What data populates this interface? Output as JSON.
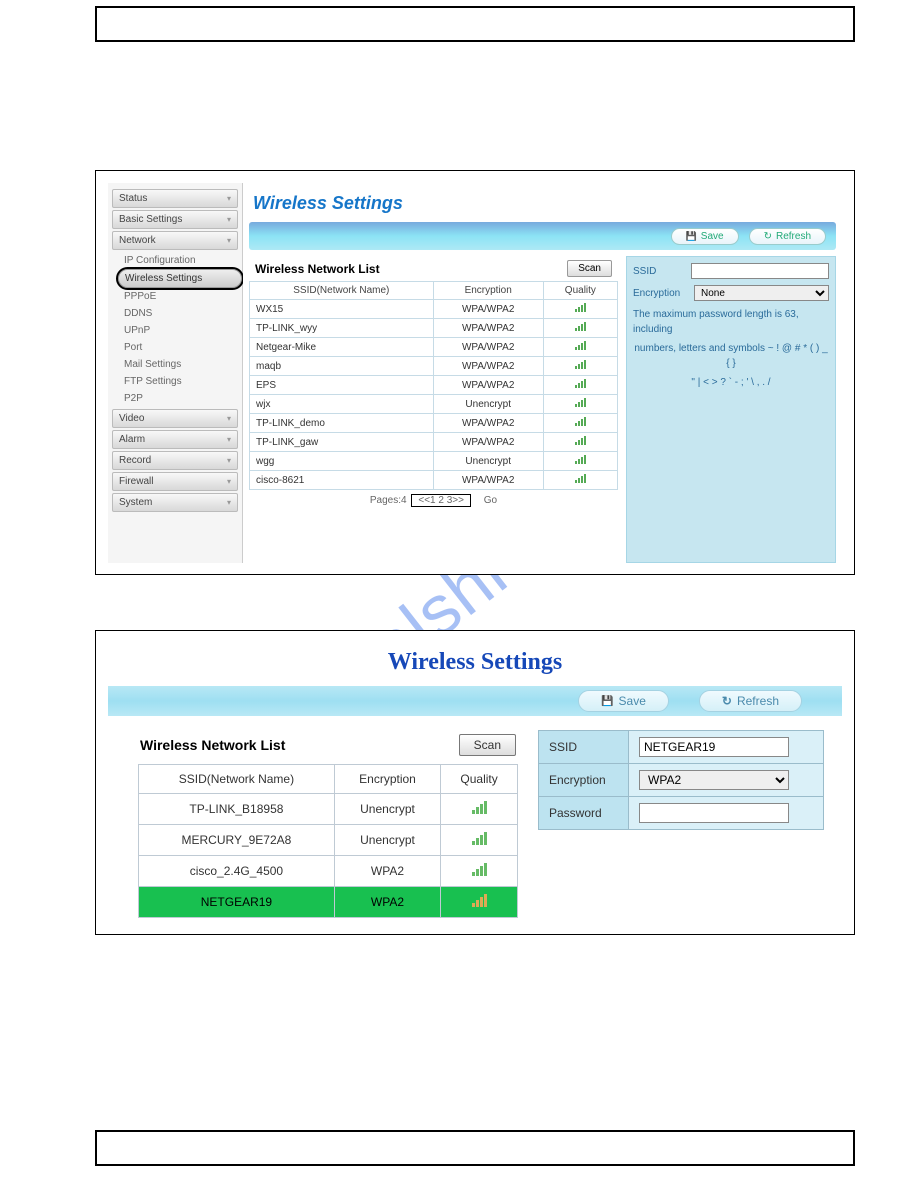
{
  "watermark": "manualshive.com",
  "panel1": {
    "title": "Wireless Settings",
    "toolbar": {
      "save": "Save",
      "refresh": "Refresh"
    },
    "sidebar": {
      "cats": [
        {
          "label": "Status",
          "type": "cat"
        },
        {
          "label": "Basic Settings",
          "type": "cat"
        },
        {
          "label": "Network",
          "type": "cat",
          "expanded": true
        },
        {
          "label": "IP Configuration",
          "type": "sub"
        },
        {
          "label": "Wireless Settings",
          "type": "sub",
          "active": true
        },
        {
          "label": "PPPoE",
          "type": "sub"
        },
        {
          "label": "DDNS",
          "type": "sub"
        },
        {
          "label": "UPnP",
          "type": "sub"
        },
        {
          "label": "Port",
          "type": "sub"
        },
        {
          "label": "Mail Settings",
          "type": "sub"
        },
        {
          "label": "FTP Settings",
          "type": "sub"
        },
        {
          "label": "P2P",
          "type": "sub"
        },
        {
          "label": "Video",
          "type": "cat"
        },
        {
          "label": "Alarm",
          "type": "cat"
        },
        {
          "label": "Record",
          "type": "cat"
        },
        {
          "label": "Firewall",
          "type": "cat"
        },
        {
          "label": "System",
          "type": "cat"
        }
      ]
    },
    "list": {
      "heading": "Wireless Network List",
      "scan": "Scan",
      "cols": [
        "SSID(Network Name)",
        "Encryption",
        "Quality"
      ],
      "rows": [
        {
          "ssid": "WX15",
          "enc": "WPA/WPA2"
        },
        {
          "ssid": "TP-LINK_wyy",
          "enc": "WPA/WPA2"
        },
        {
          "ssid": "Netgear-Mike",
          "enc": "WPA/WPA2"
        },
        {
          "ssid": "maqb",
          "enc": "WPA/WPA2"
        },
        {
          "ssid": "EPS",
          "enc": "WPA/WPA2"
        },
        {
          "ssid": "wjx",
          "enc": "Unencrypt"
        },
        {
          "ssid": "TP-LINK_demo",
          "enc": "WPA/WPA2"
        },
        {
          "ssid": "TP-LINK_gaw",
          "enc": "WPA/WPA2"
        },
        {
          "ssid": "wgg",
          "enc": "Unencrypt"
        },
        {
          "ssid": "cisco-8621",
          "enc": "WPA/WPA2"
        }
      ],
      "pager_label": "Pages:4",
      "pager_nav": "<<1 2 3>>",
      "pager_go": "Go"
    },
    "form": {
      "ssid_label": "SSID",
      "ssid_value": "",
      "enc_label": "Encryption",
      "enc_value": "None",
      "hint1": "The maximum password length is 63, including",
      "hint2": "numbers, letters and symbols ~ ! @ # * ( ) _ { }",
      "hint3": "\" | < > ? ` - ; ' \\ , . /"
    }
  },
  "panel2": {
    "title": "Wireless Settings",
    "toolbar": {
      "save": "Save",
      "refresh": "Refresh"
    },
    "list": {
      "heading": "Wireless Network List",
      "scan": "Scan",
      "cols": [
        "SSID(Network Name)",
        "Encryption",
        "Quality"
      ],
      "rows": [
        {
          "ssid": "TP-LINK_B18958",
          "enc": "Unencrypt"
        },
        {
          "ssid": "MERCURY_9E72A8",
          "enc": "Unencrypt"
        },
        {
          "ssid": "cisco_2.4G_4500",
          "enc": "WPA2"
        },
        {
          "ssid": "NETGEAR19",
          "enc": "WPA2",
          "selected": true
        }
      ]
    },
    "form": {
      "ssid_label": "SSID",
      "ssid_value": "NETGEAR19",
      "enc_label": "Encryption",
      "enc_value": "WPA2",
      "pwd_label": "Password",
      "pwd_value": ""
    }
  }
}
